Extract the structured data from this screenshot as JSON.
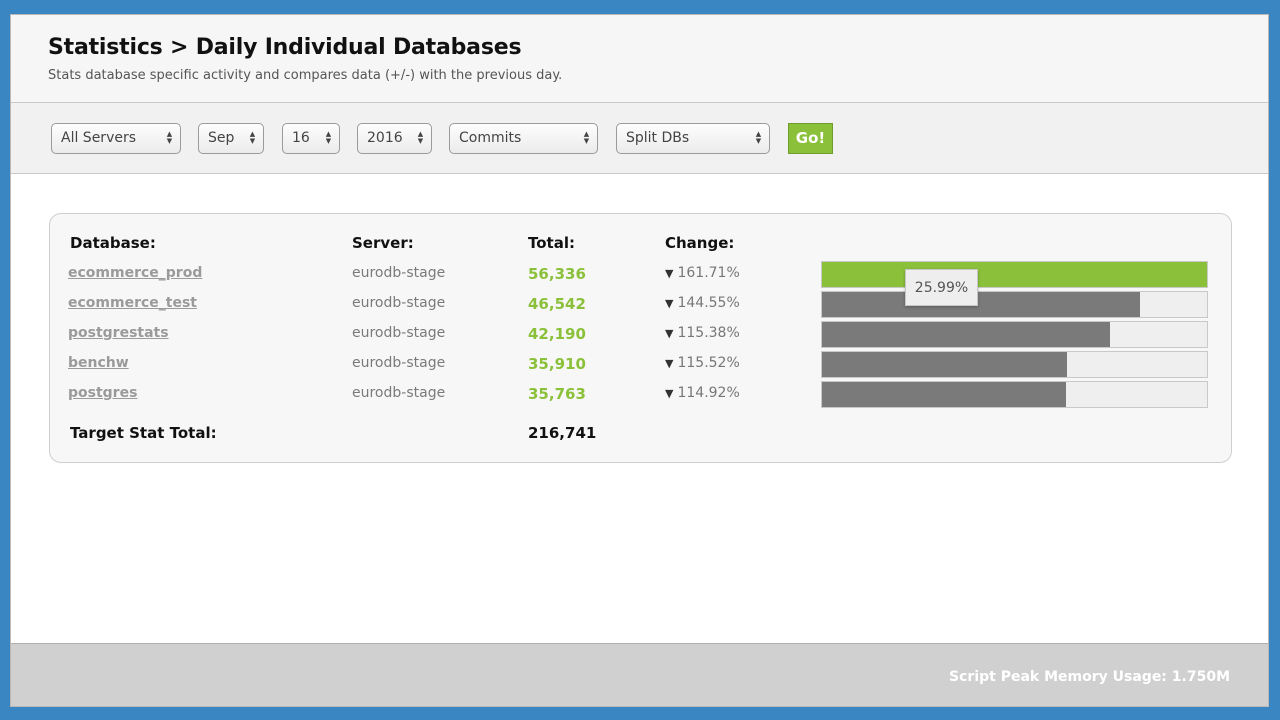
{
  "header": {
    "title": "Statistics > Daily Individual Databases",
    "subtitle": "Stats database specific activity and compares data (+/-) with the previous day."
  },
  "filters": {
    "server": "All Servers",
    "month": "Sep",
    "day": "16",
    "year": "2016",
    "stat": "Commits",
    "mode": "Split DBs",
    "go_label": "Go!"
  },
  "table": {
    "headers": {
      "database": "Database:",
      "server": "Server:",
      "total": "Total:",
      "change": "Change:"
    },
    "rows": [
      {
        "database": "ecommerce_prod",
        "server": "eurodb-stage",
        "total": "56,336",
        "change": "161.71%",
        "share": 1.0
      },
      {
        "database": "ecommerce_test",
        "server": "eurodb-stage",
        "total": "46,542",
        "change": "144.55%",
        "share": 0.8261
      },
      {
        "database": "postgrestats",
        "server": "eurodb-stage",
        "total": "42,190",
        "change": "115.38%",
        "share": 0.7489
      },
      {
        "database": "benchw",
        "server": "eurodb-stage",
        "total": "35,910",
        "change": "115.52%",
        "share": 0.6374
      },
      {
        "database": "postgres",
        "server": "eurodb-stage",
        "total": "35,763",
        "change": "114.92%",
        "share": 0.6348
      }
    ],
    "tooltip": "25.99%",
    "total_label": "Target Stat Total:",
    "total_value": "216,741"
  },
  "footer": {
    "memory": "Script Peak Memory Usage: 1.750M"
  },
  "colors": {
    "accent": "#8bc13a",
    "bar": "#7a7a7a",
    "background": "#3a86c2"
  },
  "icons": {
    "change_down": "triangle-down-icon",
    "select_arrows": "updown-arrows-icon"
  }
}
